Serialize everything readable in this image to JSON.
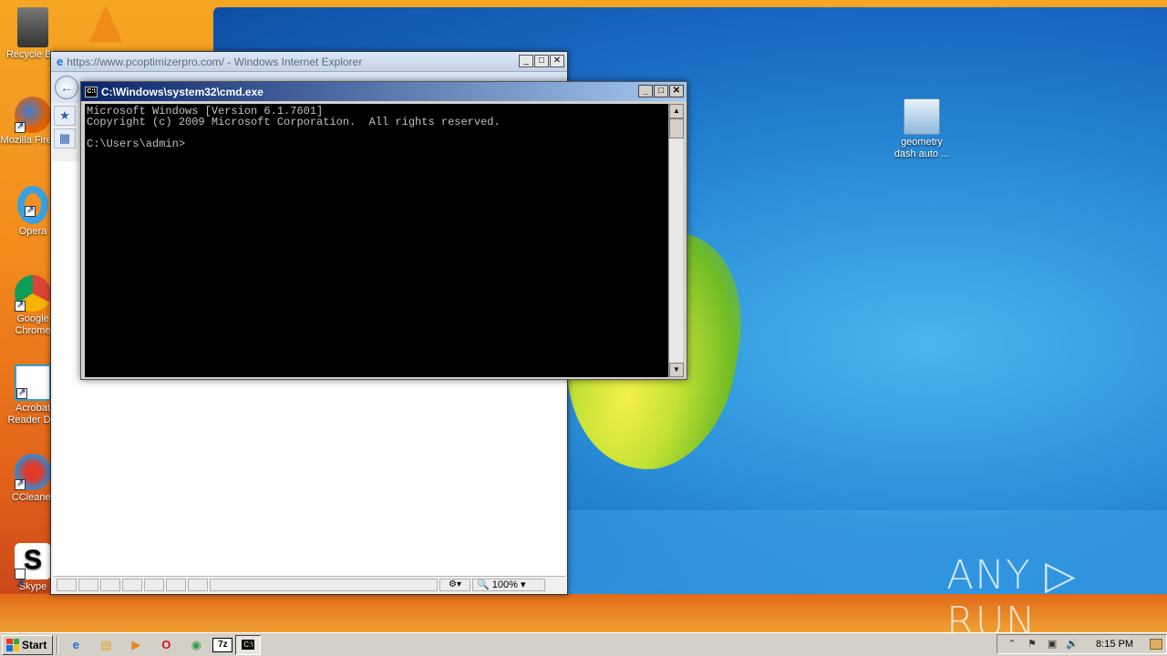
{
  "desktop": {
    "icons_left": [
      {
        "label": "Recycle Bin",
        "icon": "recycle-bin-icon"
      },
      {
        "label": "Mozilla Firefox",
        "icon": "firefox-icon"
      },
      {
        "label": "Opera",
        "icon": "opera-icon"
      },
      {
        "label": "Google Chrome",
        "icon": "chrome-icon"
      },
      {
        "label": "Acrobat Reader DC",
        "icon": "acrobat-icon"
      },
      {
        "label": "CCleaner",
        "icon": "ccleaner-icon"
      },
      {
        "label": "Skype",
        "icon": "skype-icon"
      }
    ],
    "icon_right": {
      "label_line1": "geometry",
      "label_line2": "dash auto ...",
      "icon": "installer-icon"
    },
    "vlc": {
      "icon": "vlc-icon"
    },
    "watermark": "ANY ▷ RUN"
  },
  "ie_window": {
    "title": "https://www.pcoptimizerpro.com/ - Windows Internet Explorer",
    "back_glyph": "←",
    "controls": {
      "minimize": "_",
      "maximize": "□",
      "close": "✕"
    },
    "zoom": "100%",
    "zoom_arrow": "▾"
  },
  "cmd_window": {
    "title": "C:\\Windows\\system32\\cmd.exe",
    "icon_text": "C:\\",
    "controls": {
      "minimize": "_",
      "maximize": "□",
      "close": "✕"
    },
    "lines": [
      "Microsoft Windows [Version 6.1.7601]",
      "Copyright (c) 2009 Microsoft Corporation.  All rights reserved.",
      "",
      "C:\\Users\\admin>"
    ],
    "scroll_up": "▲",
    "scroll_down": "▼"
  },
  "taskbar": {
    "start_label": "Start",
    "apps": [
      {
        "name": "ie",
        "glyph": "e",
        "color": "#1e6fd9"
      },
      {
        "name": "explorer",
        "glyph": "▤",
        "color": "#d9a520"
      },
      {
        "name": "media-player",
        "glyph": "▶",
        "color": "#e08a1e"
      },
      {
        "name": "opera",
        "glyph": "O",
        "color": "#d0141e"
      },
      {
        "name": "chrome",
        "glyph": "◉",
        "color": "#2f9d48"
      },
      {
        "name": "7zip",
        "glyph": "7z",
        "color": "#000000"
      },
      {
        "name": "cmd",
        "glyph": "C:\\",
        "color": "#000000"
      }
    ],
    "tray_icons": [
      "⌃",
      "⚑",
      "▣",
      "🔊"
    ],
    "clock": "8:15 PM"
  }
}
